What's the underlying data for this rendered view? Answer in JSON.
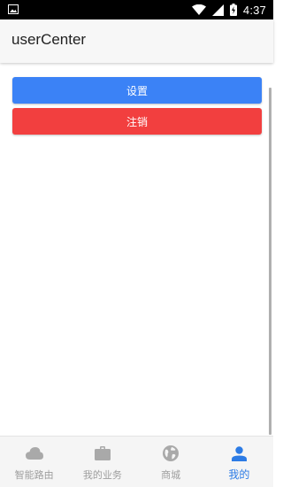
{
  "status_bar": {
    "time": "4:37"
  },
  "app_bar": {
    "title": "userCenter"
  },
  "actions": {
    "settings_label": "设置",
    "logout_label": "注销"
  },
  "bottom_nav": {
    "items": [
      {
        "label": "智能路由",
        "icon": "cloud-icon",
        "active": false
      },
      {
        "label": "我的业务",
        "icon": "briefcase-icon",
        "active": false
      },
      {
        "label": "商城",
        "icon": "globe-icon",
        "active": false
      },
      {
        "label": "我的",
        "icon": "person-icon",
        "active": true
      }
    ]
  },
  "colors": {
    "primary": "#3b82f6",
    "danger": "#f23f3f",
    "nav_active": "#2c7be5",
    "nav_inactive": "#9e9e9e"
  }
}
